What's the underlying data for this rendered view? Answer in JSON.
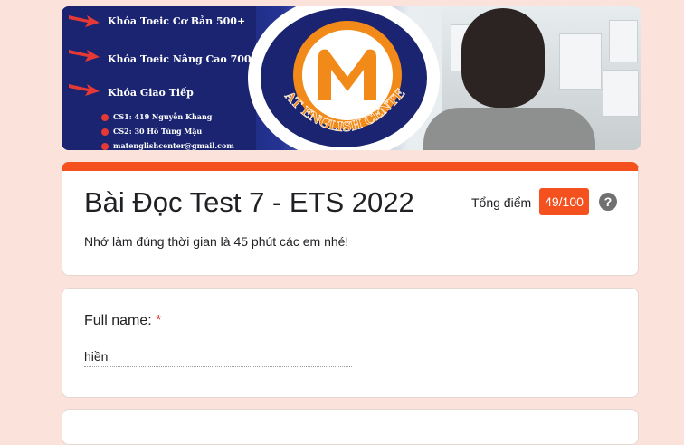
{
  "banner": {
    "courses": [
      "Khóa Toeic Cơ Bản 500+",
      "Khóa Toeic Nâng Cao 700+",
      "Khóa Giao Tiếp"
    ],
    "contacts": [
      "CS1: 419 Nguyễn Khang",
      "CS2: 30 Hồ Tùng Mậu",
      "matenglishcenter@gmail.com"
    ],
    "logo_text": "MAT ENGLISH CENTER",
    "logo_letter": "M"
  },
  "form": {
    "title": "Bài Đọc Test 7 - ETS 2022",
    "description": "Nhớ làm đúng thời gian là 45 phút các em nhé!",
    "score_label": "Tổng điểm",
    "score_value": "49/100",
    "help_glyph": "?"
  },
  "question": {
    "label": "Full name:",
    "required_mark": "*",
    "answer": "hiền"
  },
  "colors": {
    "accent": "#f4511e",
    "background": "#fbe3dc",
    "banner_navy": "#1a2470",
    "logo_orange": "#f28a1a"
  }
}
